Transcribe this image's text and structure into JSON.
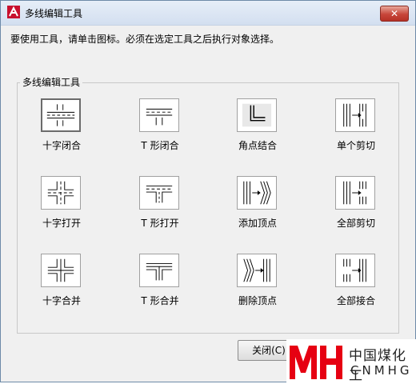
{
  "window": {
    "title": "多线编辑工具",
    "close_label": "✕"
  },
  "instruction": "要使用工具，请单击图标。必须在选定工具之后执行对象选择。",
  "group": {
    "label": "多线编辑工具",
    "tools": [
      {
        "label": "十字闭合",
        "icon": "closed-cross-icon"
      },
      {
        "label": "T 形闭合",
        "icon": "closed-tee-icon"
      },
      {
        "label": "角点结合",
        "icon": "corner-joint-icon"
      },
      {
        "label": "单个剪切",
        "icon": "cut-single-icon"
      },
      {
        "label": "十字打开",
        "icon": "open-cross-icon"
      },
      {
        "label": "T 形打开",
        "icon": "open-tee-icon"
      },
      {
        "label": "添加顶点",
        "icon": "add-vertex-icon"
      },
      {
        "label": "全部剪切",
        "icon": "cut-all-icon"
      },
      {
        "label": "十字合并",
        "icon": "merged-cross-icon"
      },
      {
        "label": "T 形合并",
        "icon": "merged-tee-icon"
      },
      {
        "label": "删除顶点",
        "icon": "delete-vertex-icon"
      },
      {
        "label": "全部接合",
        "icon": "weld-all-icon"
      }
    ]
  },
  "buttons": {
    "close_label": "关闭(C)"
  },
  "watermark": {
    "logo_letters": "MH",
    "text_cn": "中国煤化工",
    "text_en": "CNMHG"
  },
  "colors": {
    "title_bar": "#d8e4f2",
    "close_button": "#c7463a",
    "dialog_bg": "#f0f0f0",
    "watermark_red": "#e60012"
  }
}
